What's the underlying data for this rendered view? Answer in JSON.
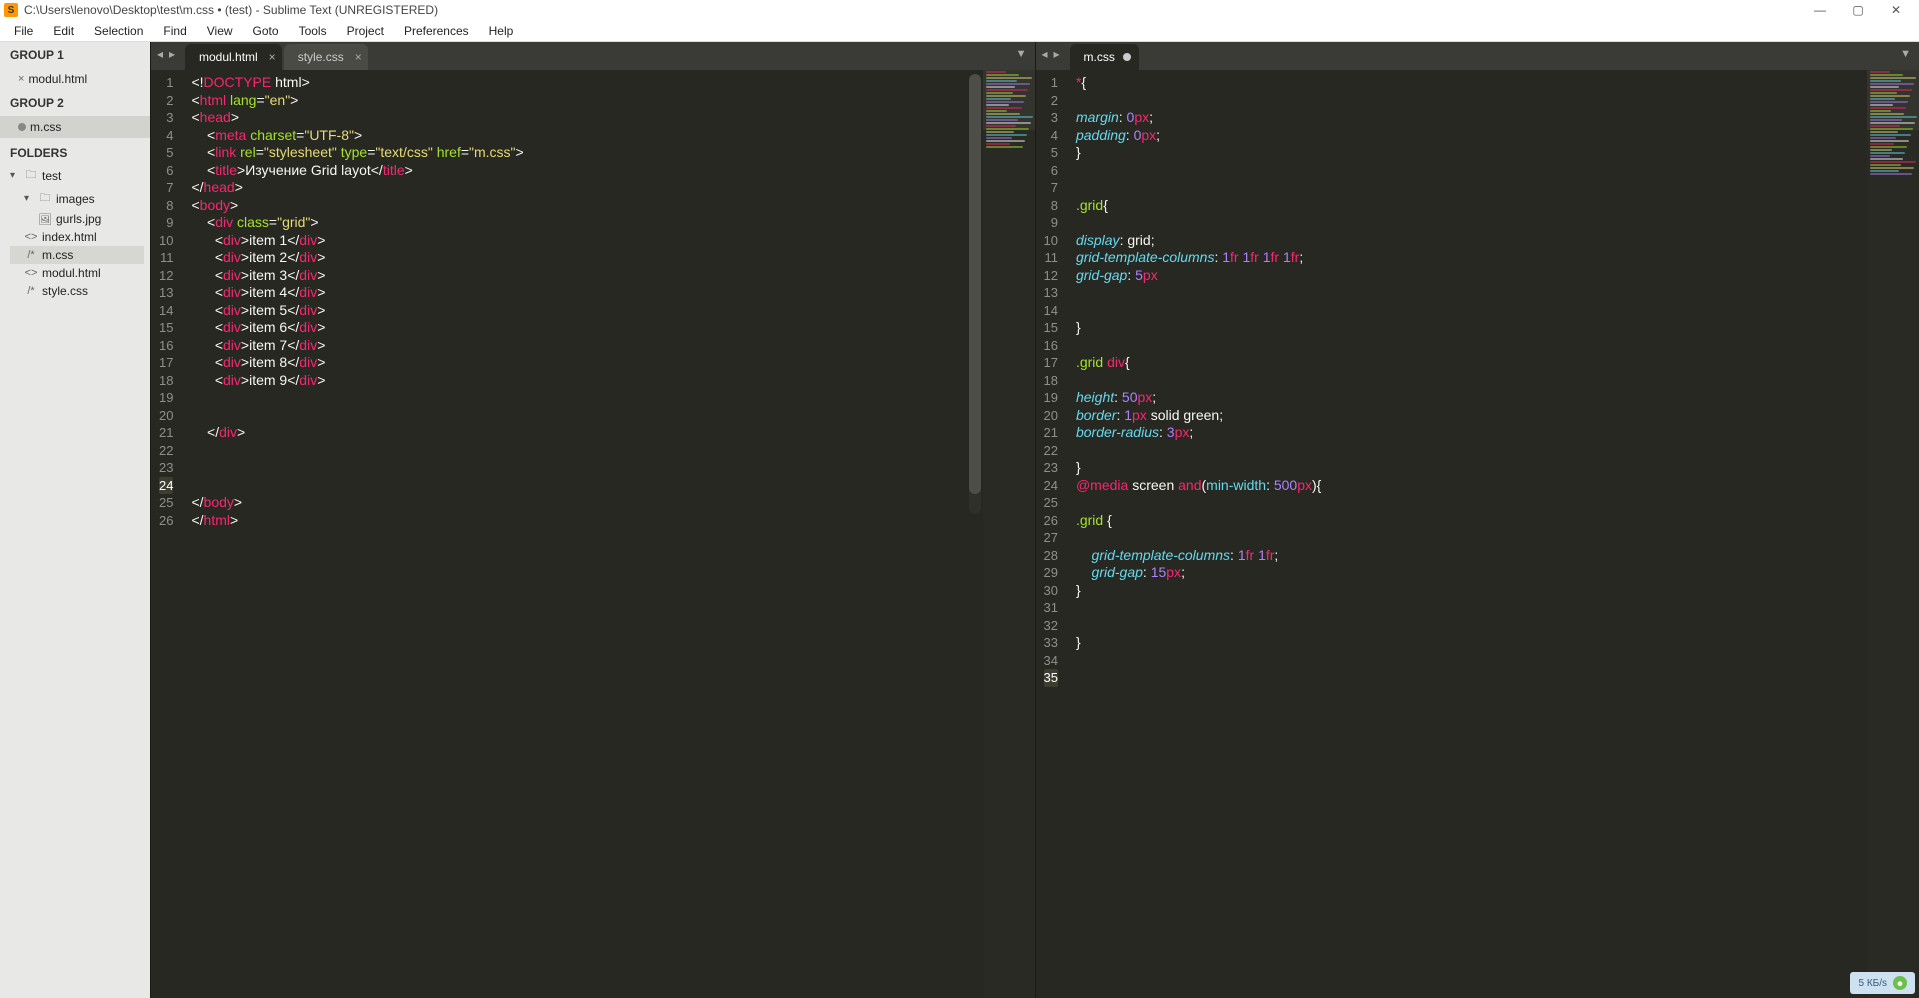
{
  "window": {
    "title": "C:\\Users\\lenovo\\Desktop\\test\\m.css • (test) - Sublime Text (UNREGISTERED)"
  },
  "menu": [
    "File",
    "Edit",
    "Selection",
    "Find",
    "View",
    "Goto",
    "Tools",
    "Project",
    "Preferences",
    "Help"
  ],
  "sidebar": {
    "group1": {
      "label": "GROUP 1",
      "file": "modul.html"
    },
    "group2": {
      "label": "GROUP 2",
      "file": "m.css"
    },
    "folders_label": "FOLDERS",
    "tree": {
      "root": "test",
      "folder": "images",
      "files": [
        "gurls.jpg",
        "index.html",
        "m.css",
        "modul.html",
        "style.css"
      ]
    }
  },
  "pane_left": {
    "tabs": [
      {
        "label": "modul.html",
        "active": true,
        "dirty": false
      },
      {
        "label": "style.css",
        "active": false,
        "dirty": false
      }
    ],
    "line_count": 26,
    "active_line": 24
  },
  "pane_right": {
    "tabs": [
      {
        "label": "m.css",
        "active": true,
        "dirty": true
      }
    ],
    "line_count": 35,
    "active_line": 35
  },
  "code_left": {
    "doctype": "DOCTYPE",
    "title_text": "Изучение Grid layot",
    "items": [
      "item 1",
      "item 2",
      "item 3",
      "item 4",
      "item 5",
      "item 6",
      "item 7",
      "item 8",
      "item 9"
    ],
    "lang": "en",
    "charset": "UTF-8",
    "rel": "stylesheet",
    "ctype": "text/css",
    "href": "m.css"
  },
  "code_right": {
    "margin": "0",
    "padding": "0",
    "cols": "1fr 1fr 1fr 1fr",
    "gap": "5",
    "height": "50",
    "border": "1px solid green",
    "radius": "3",
    "minw": "500",
    "cols2": "1fr 1fr",
    "gap2": "15"
  },
  "watermark": "5 КБ/s"
}
